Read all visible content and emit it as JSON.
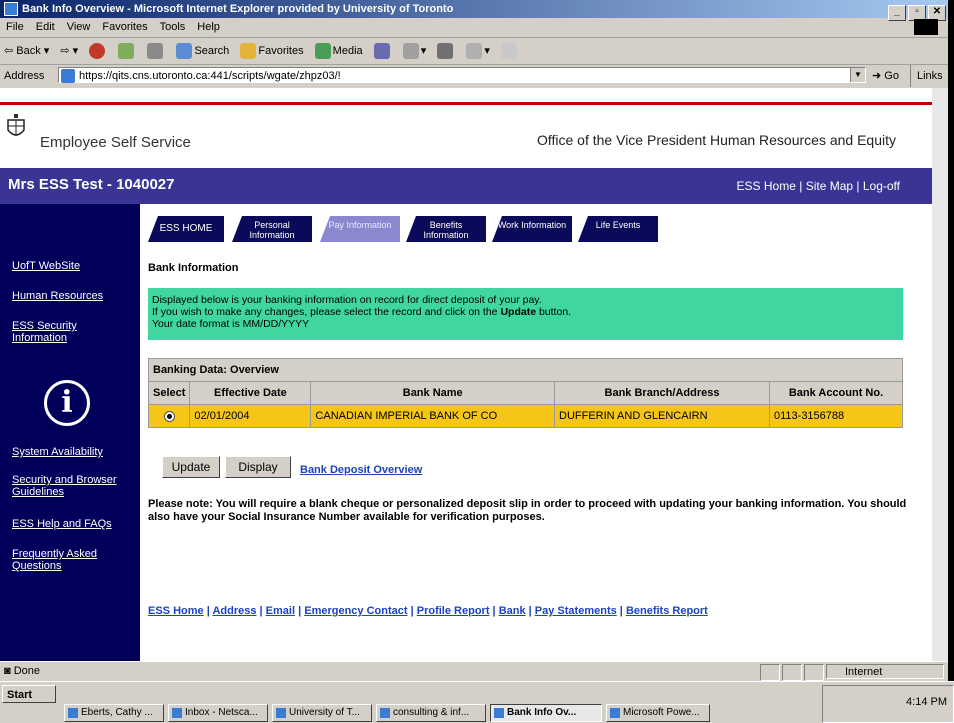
{
  "window": {
    "title": "Bank Info Overview - Microsoft Internet Explorer provided by University of Toronto"
  },
  "menu": [
    "File",
    "Edit",
    "View",
    "Favorites",
    "Tools",
    "Help"
  ],
  "toolbar": {
    "back": "Back",
    "search": "Search",
    "favorites": "Favorites",
    "media": "Media"
  },
  "address": {
    "label": "Address",
    "url": "https://qits.cns.utoronto.ca:441/scripts/wgate/zhpz03/!",
    "go": "Go",
    "links": "Links"
  },
  "header": {
    "app_title": "Employee Self Service",
    "office": "Office of the Vice President Human Resources and Equity",
    "user": "Mrs ESS Test - 1040027",
    "links": {
      "home": "ESS Home",
      "sep1": " | ",
      "sitemap": "Site Map",
      "sep2": " | ",
      "logoff": "Log-off"
    }
  },
  "sidebar": {
    "uoft": "UofT WebSite",
    "hr": "Human Resources",
    "security": "ESS Security Information",
    "availability": "System Availability",
    "browser": "Security and Browser Guidelines",
    "help": "ESS Help and FAQs",
    "faq": "Frequently Asked Questions"
  },
  "tabs": [
    {
      "label": "ESS HOME"
    },
    {
      "label": "Personal Information"
    },
    {
      "label": "Pay Information"
    },
    {
      "label": "Benefits Information"
    },
    {
      "label": "Work Information"
    },
    {
      "label": "Life Events"
    }
  ],
  "main": {
    "title": "Bank Information",
    "msg1": "Displayed below is your banking information on record for direct deposit of your pay.",
    "msg2a": "If you wish to make any changes, please select the record and click on the ",
    "msg2b": "Update",
    "msg2c": " button.",
    "msg3": "Your date format is MM/DD/YYYY",
    "table": {
      "caption": "Banking Data: Overview",
      "headers": [
        "Select",
        "Effective Date",
        "Bank Name",
        "Bank Branch/Address",
        "Bank Account No."
      ],
      "rows": [
        {
          "date": "02/01/2004",
          "bank": "CANADIAN IMPERIAL BANK OF CO",
          "branch": "DUFFERIN AND GLENCAIRN",
          "account": "0113-3156788"
        }
      ]
    },
    "update_btn": "Update",
    "display_btn": "Display",
    "deposit_link": "Bank Deposit Overview",
    "note": "Please note: You will require a blank cheque or personalized deposit slip in order to proceed with updating your banking information. You should also have your Social Insurance Number available for verification purposes."
  },
  "footer": [
    "ESS Home",
    "Address",
    "Email",
    "Emergency Contact",
    "Profile Report",
    "Bank",
    "Pay Statements",
    "Benefits Report"
  ],
  "footer_sep": " | ",
  "status": {
    "text": "Done",
    "zone": "Internet"
  },
  "taskbar": {
    "start": "Start",
    "clock": "4:14 PM",
    "tasks": [
      "Eberts, Cathy ...",
      "Inbox - Netsca...",
      "University of T...",
      "consulting & inf...",
      "Bank Info Ov...",
      "Microsoft Powe..."
    ]
  },
  "colors": {
    "header_band": "#3a3595",
    "sidebar": "#00005a",
    "message": "#3fd6a0",
    "row_highlight": "#f5c518",
    "link": "#1a44b8"
  }
}
